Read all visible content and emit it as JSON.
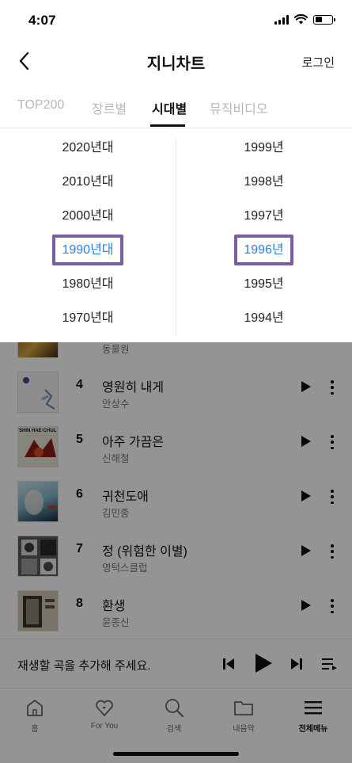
{
  "status_bar": {
    "time": "4:07"
  },
  "header": {
    "title": "지니차트",
    "login_label": "로그인"
  },
  "tabs": [
    {
      "label": "TOP200",
      "active": false
    },
    {
      "label": "장르별",
      "active": false
    },
    {
      "label": "시대별",
      "active": true
    },
    {
      "label": "뮤직비디오",
      "active": false
    }
  ],
  "picker": {
    "decades": [
      "2020년대",
      "2010년대",
      "2000년대",
      "1990년대",
      "1980년대",
      "1970년대"
    ],
    "selected_decade": "1990년대",
    "years": [
      "1999년",
      "1998년",
      "1997년",
      "1996년",
      "1995년",
      "1994년"
    ],
    "selected_year": "1996년"
  },
  "songs": [
    {
      "rank": "",
      "title": "",
      "artist": "동물원"
    },
    {
      "rank": "4",
      "title": "영원히 내게",
      "artist": "안상수"
    },
    {
      "rank": "5",
      "title": "아주 가끔은",
      "artist": "신해철"
    },
    {
      "rank": "6",
      "title": "귀천도애",
      "artist": "김민종"
    },
    {
      "rank": "7",
      "title": "정 (위험한 이별)",
      "artist": "영턱스클럽"
    },
    {
      "rank": "8",
      "title": "환생",
      "artist": "윤종신"
    }
  ],
  "album_art_text": {
    "shin_hae_chul": "SHIN HAE-CHUL"
  },
  "mini_player": {
    "prompt": "재생할 곡을 추가해 주세요."
  },
  "bottom_nav": [
    {
      "label": "홈",
      "icon": "home-icon",
      "active": false
    },
    {
      "label": "For You",
      "icon": "heart-icon",
      "active": false
    },
    {
      "label": "검색",
      "icon": "search-icon",
      "active": false
    },
    {
      "label": "내음악",
      "icon": "folder-icon",
      "active": false
    },
    {
      "label": "전체메뉴",
      "icon": "menu-icon",
      "active": true
    }
  ],
  "colors": {
    "accent_blue": "#2f7fe0",
    "highlight_border": "#7a5ea4"
  }
}
